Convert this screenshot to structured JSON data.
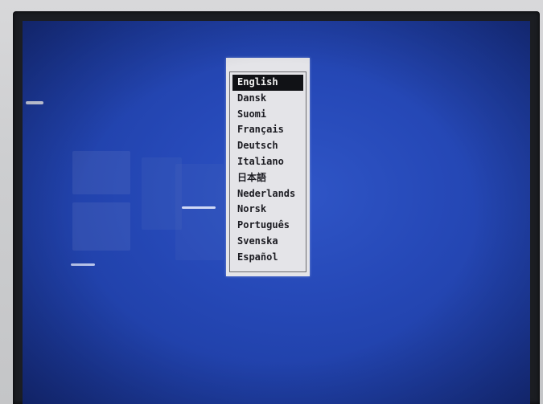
{
  "language_menu": {
    "selected_index": 0,
    "items": [
      {
        "label": "English"
      },
      {
        "label": "Dansk"
      },
      {
        "label": "Suomi"
      },
      {
        "label": "Français"
      },
      {
        "label": "Deutsch"
      },
      {
        "label": "Italiano"
      },
      {
        "label": "日本語"
      },
      {
        "label": "Nederlands"
      },
      {
        "label": "Norsk"
      },
      {
        "label": "Português"
      },
      {
        "label": "Svenska"
      },
      {
        "label": "Español"
      }
    ]
  },
  "colors": {
    "screen_blue": "#2649b8",
    "menu_background": "#e4e4e8",
    "highlight": "#111216"
  }
}
